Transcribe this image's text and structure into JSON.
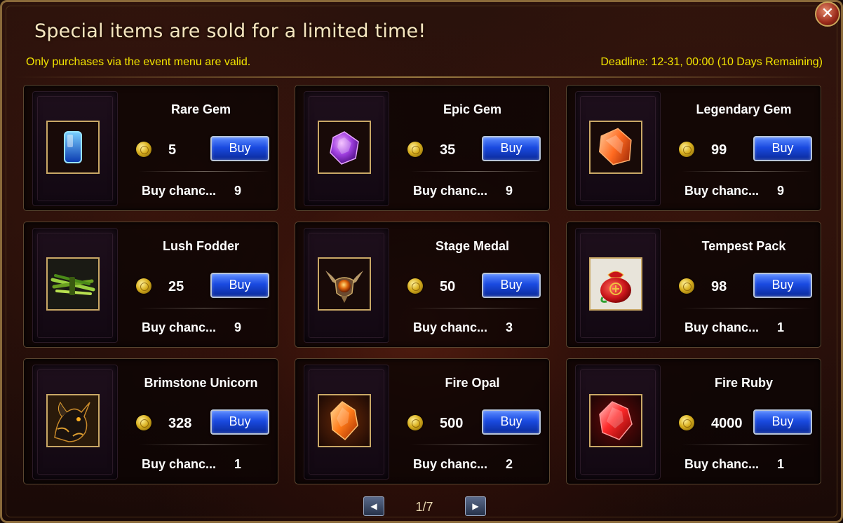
{
  "dialog": {
    "title": "Special items are sold for a limited time!",
    "notice": "Only purchases via the event menu are valid.",
    "deadline": "Deadline: 12-31, 00:00 (10 Days Remaining)",
    "close_icon": "close-icon"
  },
  "items": [
    {
      "name": "Rare Gem",
      "price": "5",
      "buy_label": "Buy",
      "chance_label": "Buy chanc...",
      "chance": "9",
      "icon": "blue-gem-icon"
    },
    {
      "name": "Epic Gem",
      "price": "35",
      "buy_label": "Buy",
      "chance_label": "Buy chanc...",
      "chance": "9",
      "icon": "purple-gem-icon"
    },
    {
      "name": "Legendary Gem",
      "price": "99",
      "buy_label": "Buy",
      "chance_label": "Buy chanc...",
      "chance": "9",
      "icon": "orange-gem-icon"
    },
    {
      "name": "Lush Fodder",
      "price": "25",
      "buy_label": "Buy",
      "chance_label": "Buy chanc...",
      "chance": "9",
      "icon": "fodder-icon"
    },
    {
      "name": "Stage Medal",
      "price": "50",
      "buy_label": "Buy",
      "chance_label": "Buy chanc...",
      "chance": "3",
      "icon": "medal-icon"
    },
    {
      "name": "Tempest Pack",
      "price": "98",
      "buy_label": "Buy",
      "chance_label": "Buy chanc...",
      "chance": "1",
      "icon": "red-pouch-icon"
    },
    {
      "name": "Brimstone Unicorn",
      "price": "328",
      "buy_label": "Buy",
      "chance_label": "Buy chanc...",
      "chance": "1",
      "icon": "unicorn-icon"
    },
    {
      "name": "Fire Opal",
      "price": "500",
      "buy_label": "Buy",
      "chance_label": "Buy chanc...",
      "chance": "2",
      "icon": "fire-opal-icon"
    },
    {
      "name": "Fire Ruby",
      "price": "4000",
      "buy_label": "Buy",
      "chance_label": "Buy chanc...",
      "chance": "1",
      "icon": "fire-ruby-icon"
    }
  ],
  "pagination": {
    "page": "1/7",
    "prev_icon": "arrow-left-icon",
    "next_icon": "arrow-right-icon"
  },
  "colors": {
    "notice_text": "#f2e400",
    "buy_button": "#1a4ae0",
    "card_border": "#5a4630",
    "frame_border": "#8a6a3a"
  }
}
